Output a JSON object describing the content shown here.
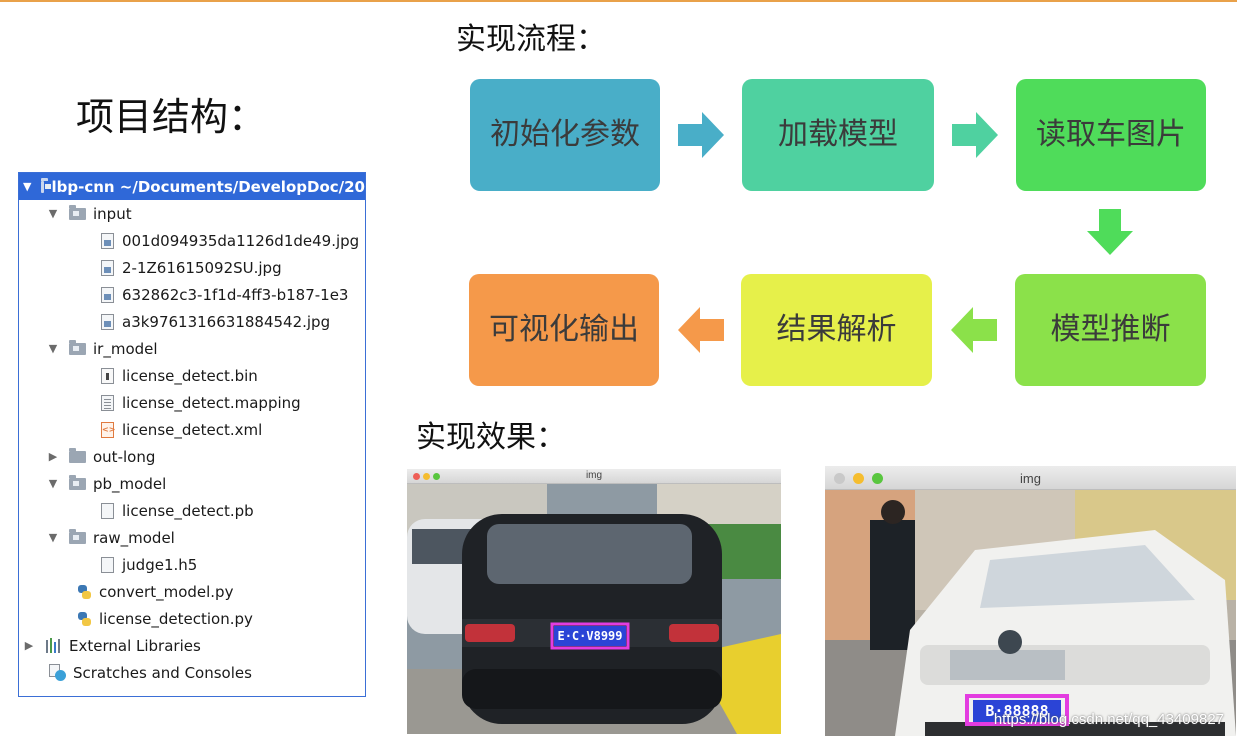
{
  "headings": {
    "structure": "项目结构：",
    "flow": "实现流程：",
    "effect": "实现效果："
  },
  "tree": [
    {
      "label": "lbp-cnn ~/Documents/DevelopDoc/20",
      "kind": "folder",
      "state": "expanded",
      "selected": true
    },
    {
      "label": "input",
      "kind": "folder",
      "state": "expanded"
    },
    {
      "label": "001d094935da1126d1de49.jpg",
      "kind": "image-file"
    },
    {
      "label": "2-1Z61615092SU.jpg",
      "kind": "image-file"
    },
    {
      "label": "632862c3-1f1d-4ff3-b187-1e3",
      "kind": "image-file"
    },
    {
      "label": "a3k9761316631884542.jpg",
      "kind": "image-file"
    },
    {
      "label": "ir_model",
      "kind": "folder",
      "state": "expanded"
    },
    {
      "label": "license_detect.bin",
      "kind": "binary-file"
    },
    {
      "label": "license_detect.mapping",
      "kind": "text-file"
    },
    {
      "label": "license_detect.xml",
      "kind": "xml-file"
    },
    {
      "label": "out-long",
      "kind": "folder",
      "state": "collapsed"
    },
    {
      "label": "pb_model",
      "kind": "folder",
      "state": "expanded"
    },
    {
      "label": "license_detect.pb",
      "kind": "blank-file"
    },
    {
      "label": "raw_model",
      "kind": "folder",
      "state": "expanded"
    },
    {
      "label": "judge1.h5",
      "kind": "blank-file"
    },
    {
      "label": "convert_model.py",
      "kind": "python-file"
    },
    {
      "label": "license_detection.py",
      "kind": "python-file"
    },
    {
      "label": "External Libraries",
      "kind": "libraries",
      "state": "collapsed"
    },
    {
      "label": "Scratches and Consoles",
      "kind": "scratches"
    }
  ],
  "flow_steps": [
    {
      "label": "初始化参数",
      "color": "#49aec8"
    },
    {
      "label": "加载模型",
      "color": "#4fd1a0"
    },
    {
      "label": "读取车图片",
      "color": "#4fdc5a"
    },
    {
      "label": "模型推断",
      "color": "#8be14a"
    },
    {
      "label": "结果解析",
      "color": "#e6f04a"
    },
    {
      "label": "可视化输出",
      "color": "#f5994a"
    }
  ],
  "flow_arrow_colors": [
    "#49aec8",
    "#4fd1a0",
    "#4fdc5a",
    "#8be14a",
    "#e6f04a",
    "#f5994a"
  ],
  "result_windows": [
    {
      "title": "img",
      "plate_text": "E·C·V8999"
    },
    {
      "title": "img",
      "plate_text": "B·88888"
    }
  ],
  "watermark": "https://blog.csdn.net/qq_43409827",
  "colors": {
    "accent_rule": "#e9a14a",
    "tree_selection": "#2f68d8",
    "detection_box": "#e33ce0",
    "plate_blue": "#2b44d6"
  }
}
